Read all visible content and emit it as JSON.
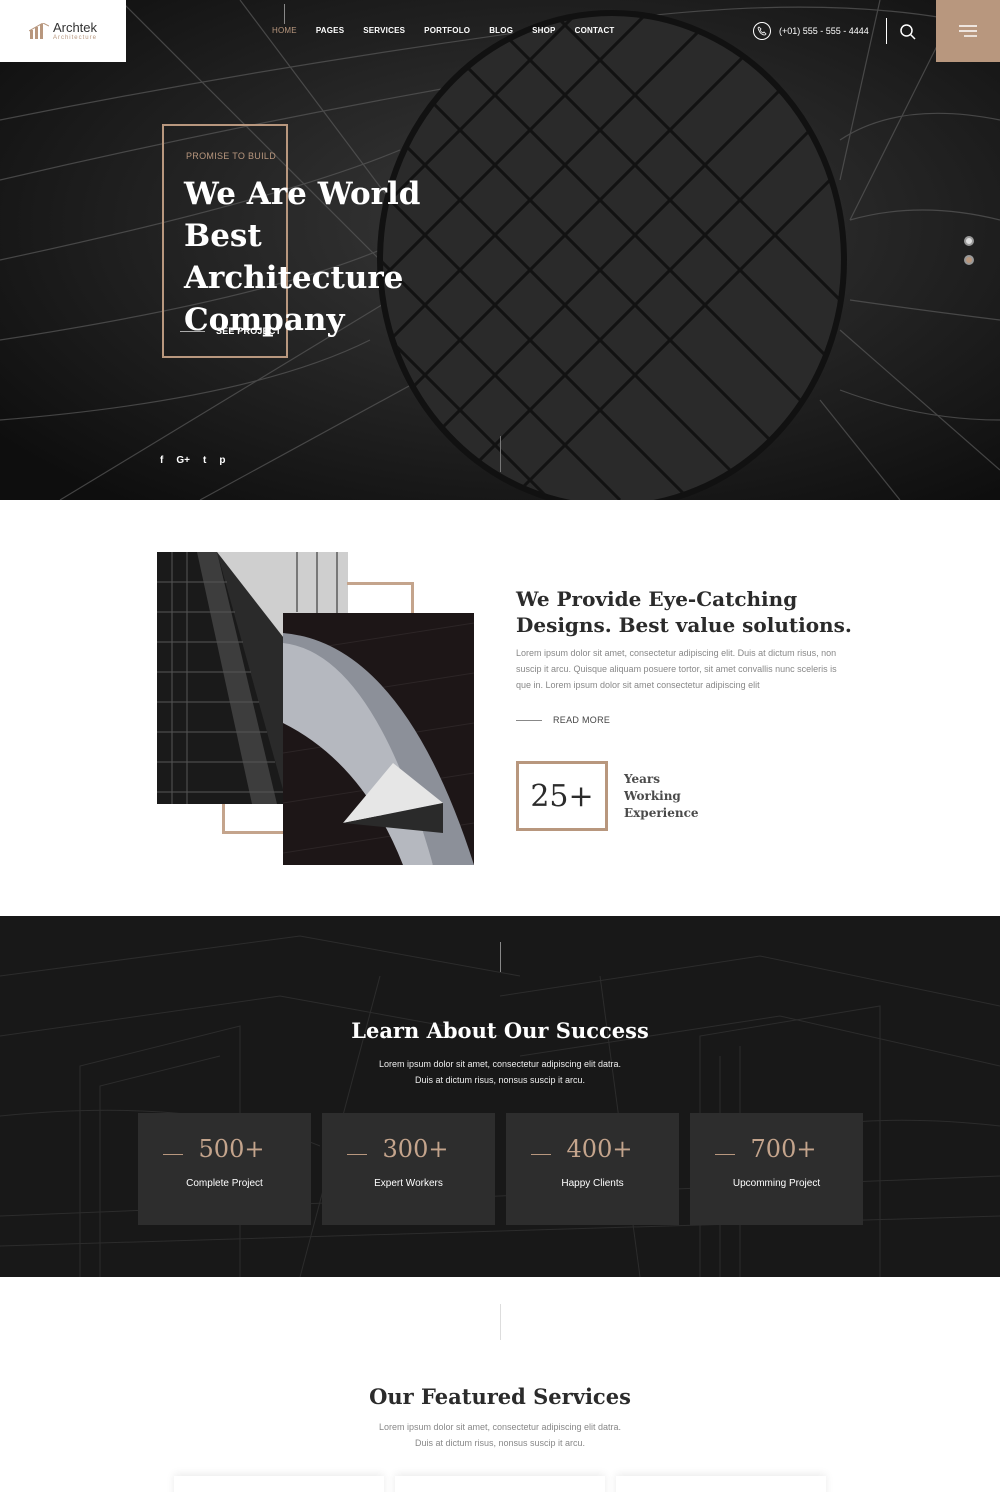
{
  "header": {
    "logo": {
      "name": "Archtek",
      "tagline": "Architecture"
    },
    "nav": [
      {
        "label": "HOME",
        "active": true
      },
      {
        "label": "PAGES"
      },
      {
        "label": "SERVICES"
      },
      {
        "label": "PORTFOLO"
      },
      {
        "label": "BLOG"
      },
      {
        "label": "SHOP"
      },
      {
        "label": "CONTACT"
      }
    ],
    "phone": "(+01) 555 - 555 - 4444",
    "icons": {
      "phone": "phone-icon",
      "search": "search-icon",
      "menu": "hamburger-icon"
    }
  },
  "hero": {
    "kicker": "PROMISE TO BUILD",
    "title_lines": [
      "We Are World",
      "Best Architecture",
      "Company"
    ],
    "cta": "SEE PROJECT",
    "social": [
      {
        "icon": "facebook-icon",
        "glyph": "f"
      },
      {
        "icon": "google-plus-icon",
        "glyph": "G+"
      },
      {
        "icon": "twitter-icon",
        "glyph": "t"
      },
      {
        "icon": "pinterest-icon",
        "glyph": "p"
      }
    ],
    "slider_count": 2,
    "active_slide": 1
  },
  "about": {
    "title": "We Provide Eye-Catching Designs. Best value solutions.",
    "text": "Lorem ipsum dolor sit amet, consectetur adipiscing elit. Duis at dictum risus, non suscip it arcu. Quisque aliquam posuere tortor, sit amet convallis nunc sceleris is que in. Lorem ipsum dolor sit amet consectetur adipiscing elit",
    "read_more": "READ MORE",
    "years_value": "25+",
    "years_label_lines": [
      "Years",
      "Working",
      "Experience"
    ]
  },
  "success": {
    "title": "Learn About Our Success",
    "text_lines": [
      "Lorem ipsum dolor sit amet, consectetur adipiscing elit datra.",
      "Duis at dictum risus, nonsus suscip it arcu."
    ],
    "stats": [
      {
        "value": "500+",
        "label": "Complete Project"
      },
      {
        "value": "300+",
        "label": "Expert Workers"
      },
      {
        "value": "400+",
        "label": "Happy Clients"
      },
      {
        "value": "700+",
        "label": "Upcomming Project"
      }
    ]
  },
  "services": {
    "title": "Our Featured Services",
    "text_lines": [
      "Lorem ipsum dolor sit amet, consectetur adipiscing elit datra.",
      "Duis at dictum risus, nonsus suscip it arcu."
    ]
  },
  "colors": {
    "accent": "#b8977e",
    "dark": "#181818",
    "text": "#2b2b2b",
    "muted": "#888888"
  }
}
